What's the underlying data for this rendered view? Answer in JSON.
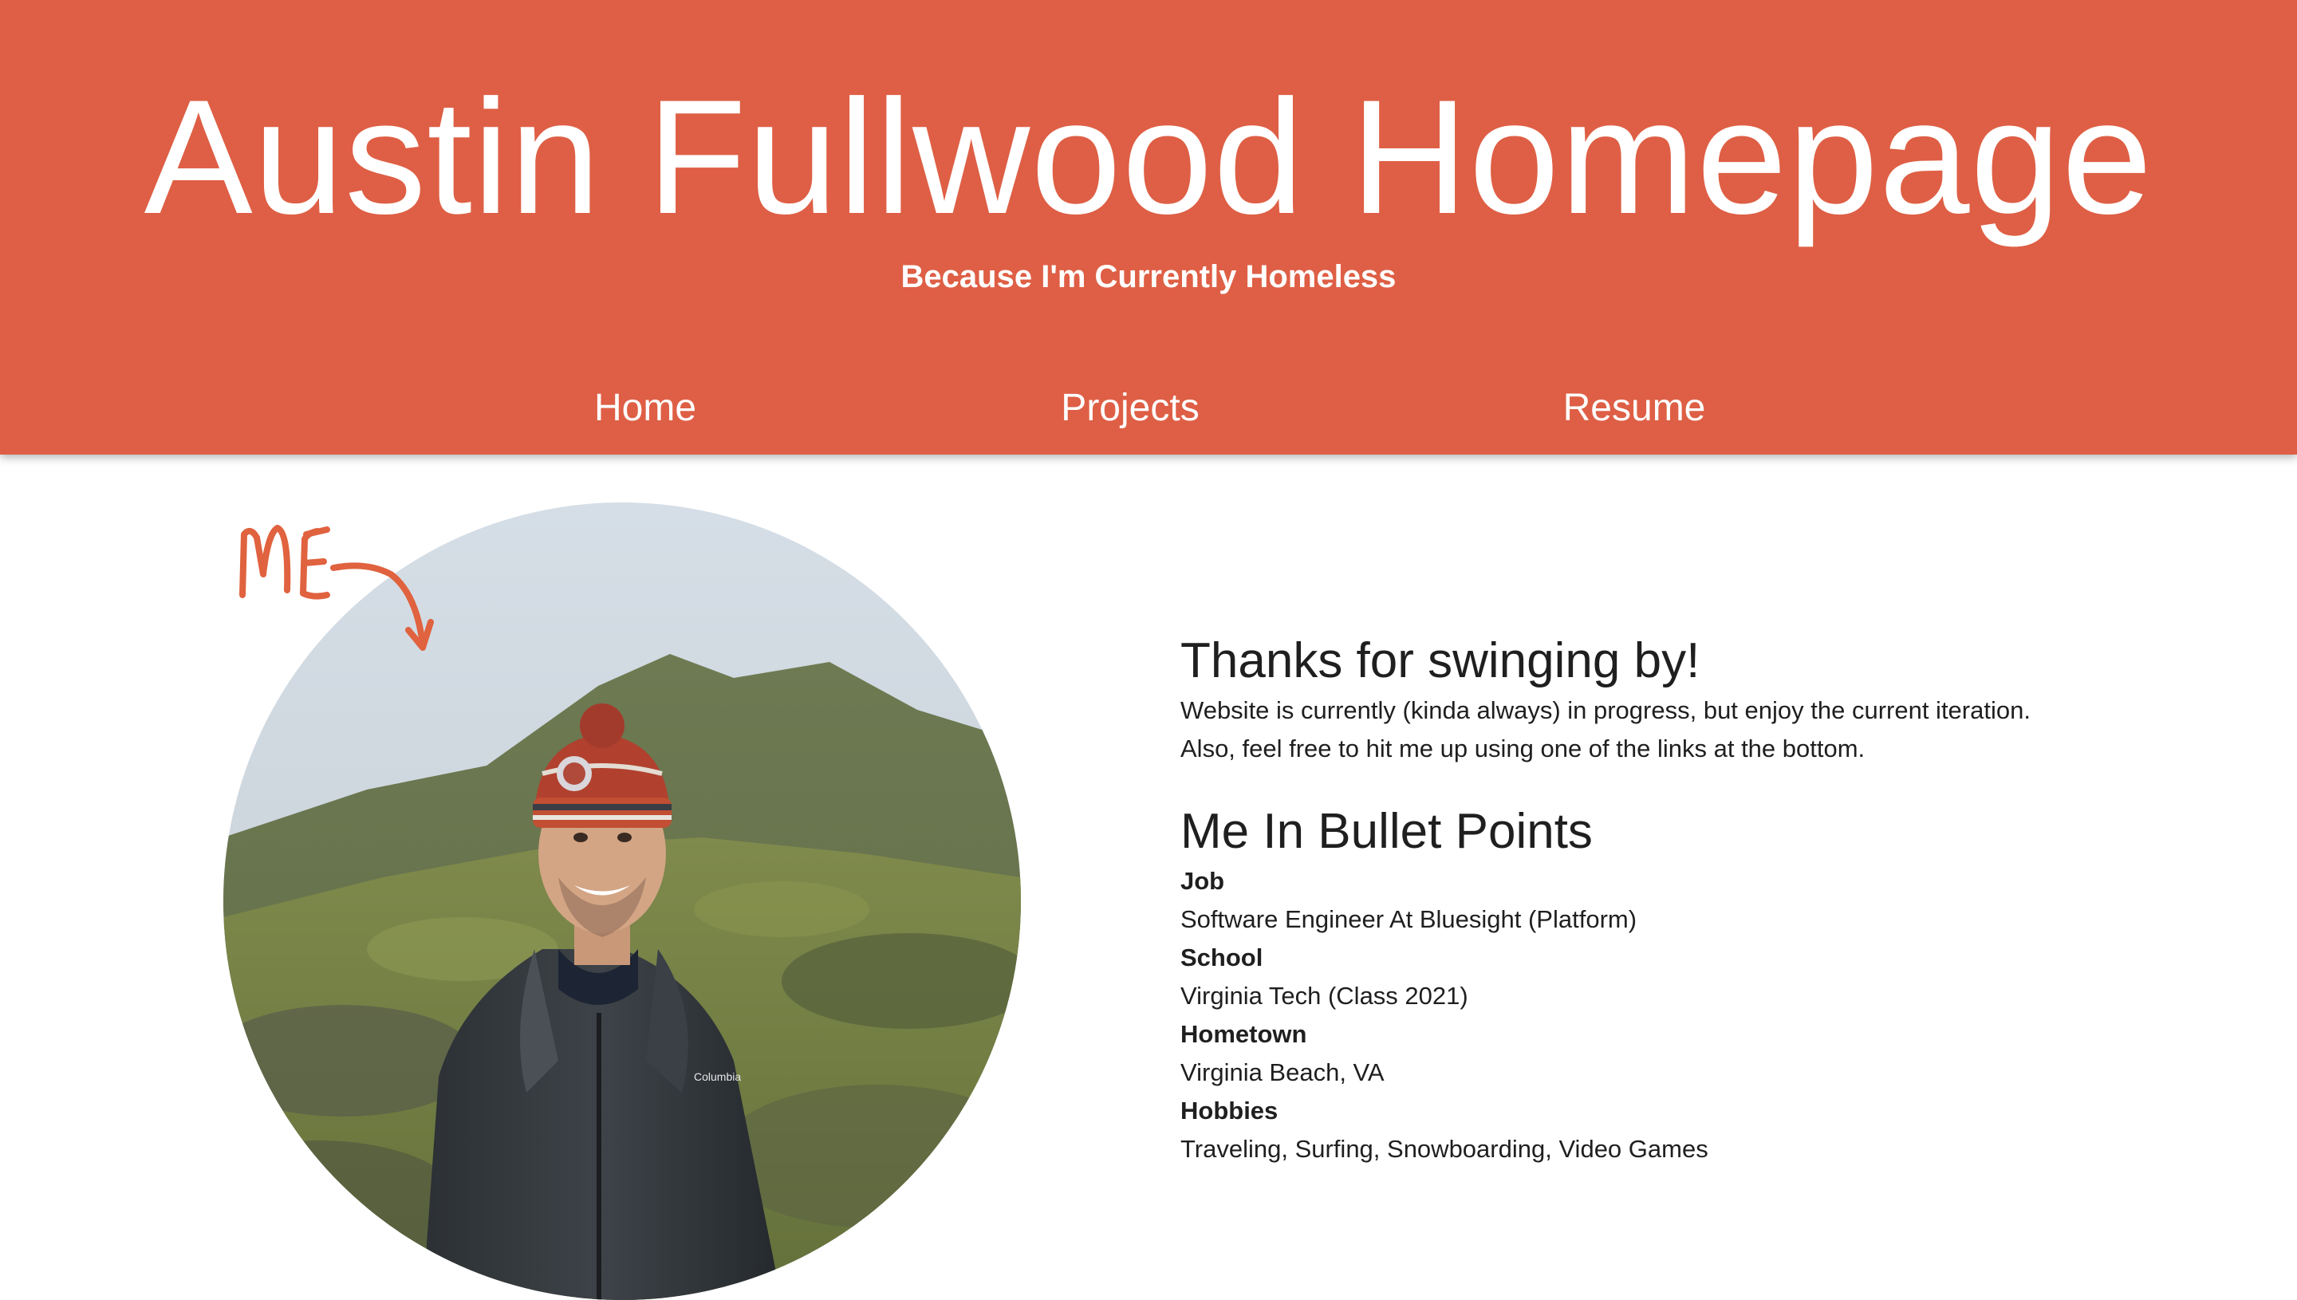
{
  "header": {
    "title": "Austin Fullwood Homepage",
    "subtitle": "Because I'm Currently Homeless",
    "background_color": "#de5f45"
  },
  "nav": {
    "items": [
      {
        "label": "Home"
      },
      {
        "label": "Projects"
      },
      {
        "label": "Resume"
      }
    ]
  },
  "photo": {
    "annotation_text": "ME",
    "annotation_color": "#e0623f"
  },
  "intro": {
    "heading": "Thanks for swinging by!",
    "lines": [
      "Website is currently (kinda always) in progress, but enjoy the current iteration.",
      "Also, feel free to hit me up using one of the links at the bottom."
    ]
  },
  "bullets": {
    "heading": "Me In Bullet Points",
    "items": [
      {
        "label": "Job",
        "value": "Software Engineer At Bluesight (Platform)"
      },
      {
        "label": "School",
        "value": "Virginia Tech (Class 2021)"
      },
      {
        "label": "Hometown",
        "value": "Virginia Beach, VA"
      },
      {
        "label": "Hobbies",
        "value": "Traveling, Surfing, Snowboarding, Video Games"
      }
    ]
  }
}
